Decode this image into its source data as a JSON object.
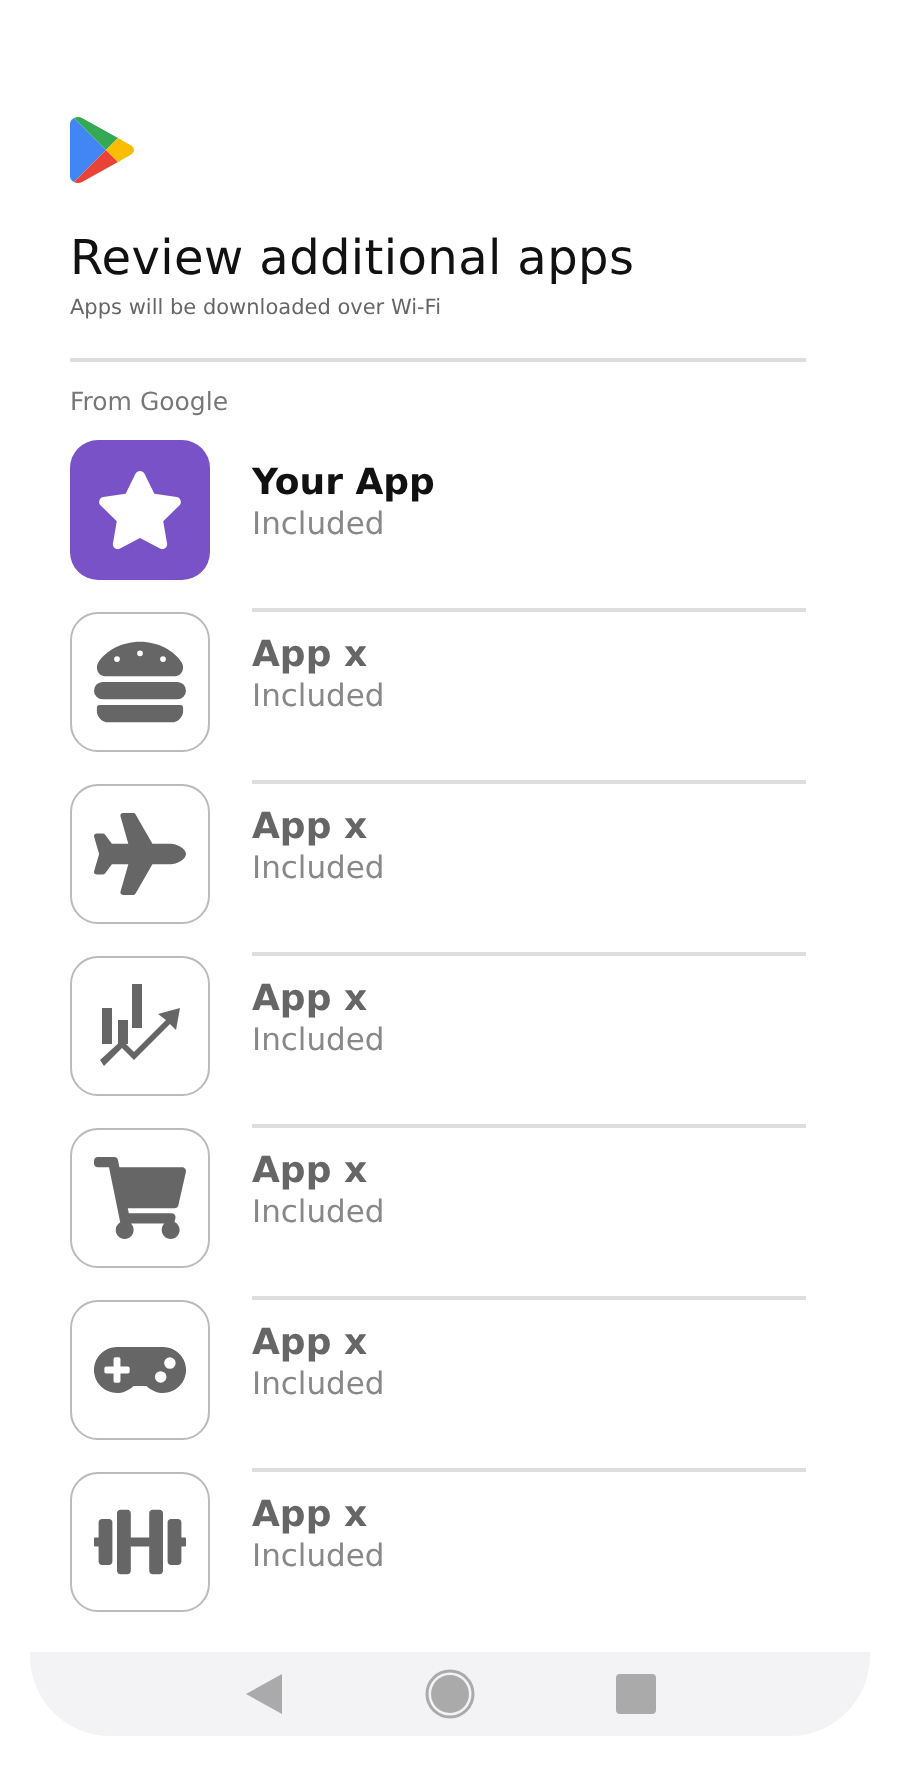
{
  "header": {
    "title": "Review additional apps",
    "subtitle": "Apps will be downloaded over Wi-Fi"
  },
  "section": {
    "label": "From Google"
  },
  "apps": [
    {
      "kind": "featured",
      "name": "Your App",
      "status": "Included"
    },
    {
      "kind": "standard",
      "name": "App x",
      "status": "Included"
    },
    {
      "kind": "standard",
      "name": "App x",
      "status": "Included"
    },
    {
      "kind": "standard",
      "name": "App x",
      "status": "Included"
    },
    {
      "kind": "standard",
      "name": "App x",
      "status": "Included"
    },
    {
      "kind": "standard",
      "name": "App x",
      "status": "Included"
    },
    {
      "kind": "standard",
      "name": "App x",
      "status": "Included"
    }
  ]
}
